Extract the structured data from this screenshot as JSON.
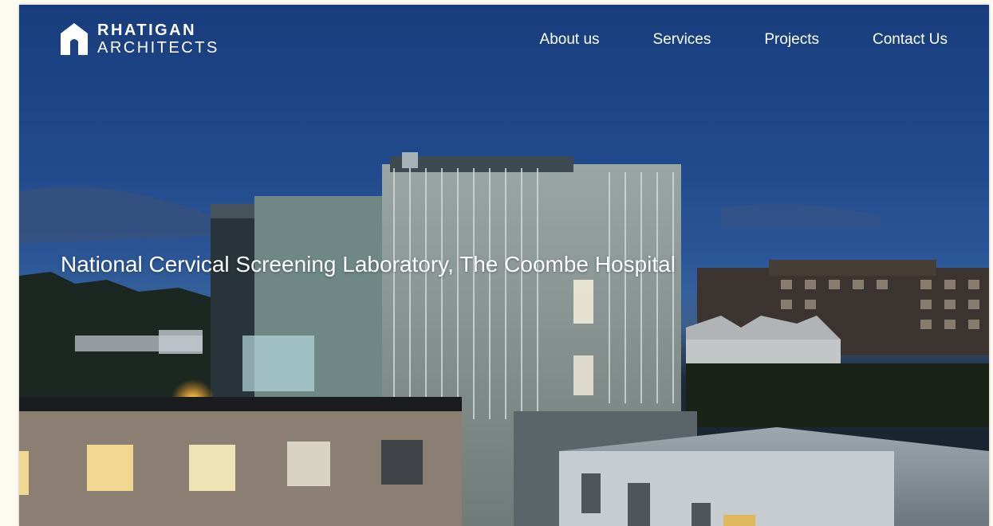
{
  "brand": {
    "line1": "RHATIGAN",
    "line2": "ARCHITECTS",
    "logo_icon": "house-outline-logo-icon"
  },
  "nav": {
    "items": [
      {
        "label": "About us"
      },
      {
        "label": "Services"
      },
      {
        "label": "Projects"
      },
      {
        "label": "Contact Us"
      }
    ]
  },
  "hero": {
    "title": "National Cervical Screening Laboratory, The Coombe Hospital",
    "image_subject": "laboratory building at dusk"
  },
  "colors": {
    "sky_top": "#183d7d",
    "text": "#ffffff",
    "page_background": "#fdfbf1"
  }
}
